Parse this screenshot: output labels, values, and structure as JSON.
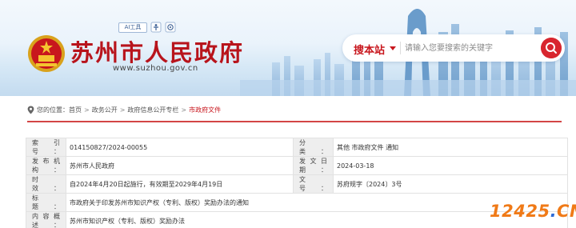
{
  "header": {
    "site_title": "苏州市人民政府",
    "site_url": "www.suzhou.gov.cn",
    "ai_tag": "AI工具",
    "icons": [
      "accessibility-icon",
      "elder-mode-icon"
    ]
  },
  "search": {
    "scope_label": "搜本站",
    "placeholder": "请输入您要搜索的关键字",
    "button_icon": "search-icon"
  },
  "breadcrumb": {
    "location_label": "您的位置：",
    "items": [
      "首页",
      "政务公开",
      "政府信息公开专栏",
      "市政府文件"
    ],
    "separator": ">"
  },
  "info_table": {
    "index_label": "索 引 号：",
    "index_value": "014150827/2024-00055",
    "category_label": "分　　类：",
    "category_value": "其他 市政府文件 通知",
    "issuer_label": "发布机构：",
    "issuer_value": "苏州市人民政府",
    "date_label": "发文日期：",
    "date_value": "2024-03-18",
    "validity_label": "时　　效：",
    "validity_value": "自2024年4月20日起施行，有效期至2029年4月19日",
    "docno_label": "文　　号：",
    "docno_value": "苏府规字〔2024〕3号",
    "title_label": "标　　题：",
    "title_value": "市政府关于印发苏州市知识产权（专利、版权）奖励办法的通知",
    "summary_label": "内容概述：",
    "summary_value": "苏州市知识产权（专利、版权）奖励办法"
  },
  "watermark": {
    "prefix": "12425",
    "dot": ".",
    "suffix": "CN"
  },
  "colors": {
    "brand_red": "#c8161d",
    "banner_blue": "#d6e8f6",
    "label_bg": "#eeeeee"
  }
}
